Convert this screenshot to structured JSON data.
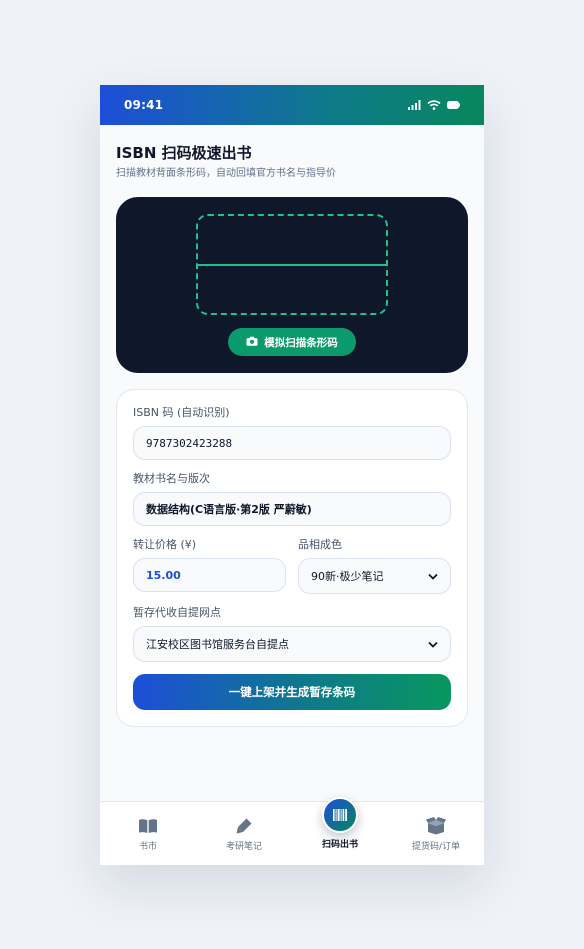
{
  "status_bar": {
    "time": "09:41",
    "icons": [
      "signal-icon",
      "wifi-icon",
      "battery-icon"
    ]
  },
  "header": {
    "title": "ISBN 扫码极速出书",
    "subtitle": "扫描教材背面条形码，自动回填官方书名与指导价"
  },
  "scanner": {
    "button_label": "模拟扫描条形码",
    "button_icon": "camera-icon",
    "frame_color": "#22c08a"
  },
  "form": {
    "isbn": {
      "label": "ISBN 码 (自动识别)",
      "value": "9787302423288"
    },
    "book_title": {
      "label": "教材书名与版次",
      "value": "数据结构(C语言版·第2版 严蔚敏)"
    },
    "price": {
      "label": "转让价格 (¥)",
      "value": "15.00"
    },
    "condition": {
      "label": "品相成色",
      "selected": "90新·极少笔记"
    },
    "pickup_point": {
      "label": "暂存代收自提网点",
      "selected": "江安校区图书馆服务台自提点"
    },
    "submit_label": "一键上架并生成暂存条码"
  },
  "tab_bar": {
    "items": [
      {
        "label": "书市",
        "icon": "book-open-icon"
      },
      {
        "label": "考研笔记",
        "icon": "pen-icon"
      },
      {
        "label": "扫码出书",
        "icon": "barcode-icon",
        "active": true
      },
      {
        "label": "提货码/订单",
        "icon": "box-open-icon"
      }
    ]
  },
  "colors": {
    "primary_blue": "#1d4ed8",
    "primary_green": "#08875c",
    "scanner_bg": "#0f172a",
    "price_text": "#1d4ed8"
  }
}
